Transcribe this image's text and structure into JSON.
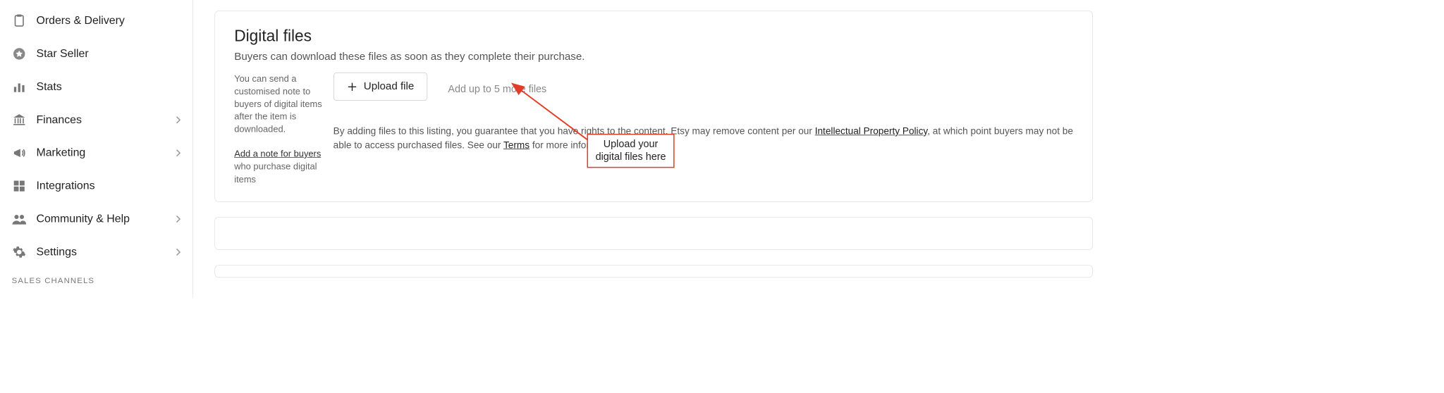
{
  "sidebar": {
    "items": [
      {
        "label": "Orders & Delivery",
        "has_chevron": false
      },
      {
        "label": "Star Seller",
        "has_chevron": false
      },
      {
        "label": "Stats",
        "has_chevron": false
      },
      {
        "label": "Finances",
        "has_chevron": true
      },
      {
        "label": "Marketing",
        "has_chevron": true
      },
      {
        "label": "Integrations",
        "has_chevron": false
      },
      {
        "label": "Community & Help",
        "has_chevron": true
      },
      {
        "label": "Settings",
        "has_chevron": true
      }
    ],
    "section_label": "SALES CHANNELS"
  },
  "panel": {
    "title": "Digital files",
    "subtitle": "Buyers can download these files as soon as they complete their purchase.",
    "note_intro": "You can send a customised note to buyers of digital items after the item is downloaded.",
    "note_link": "Add a note for buyers",
    "note_tail": " who purchase digital items",
    "upload_button": "Upload file",
    "upload_hint": "Add up to 5 more files",
    "legal_pre": "By adding files to this listing, you guarantee that you have rights to the content. Etsy may remove content per our ",
    "legal_link1": "Intellectual Property Policy",
    "legal_mid": ", at which point buyers may not be able to access purchased files. See our ",
    "legal_link2": "Terms",
    "legal_post": " for more information."
  },
  "annotation": {
    "line1": "Upload your",
    "line2": "digital files here"
  }
}
